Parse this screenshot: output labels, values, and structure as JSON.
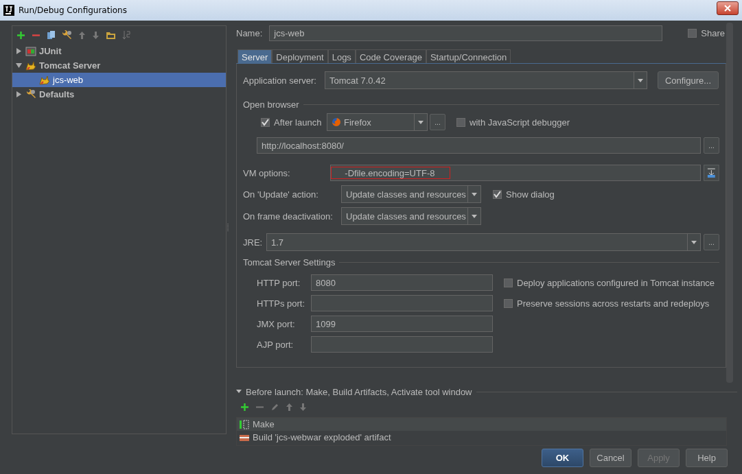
{
  "window": {
    "title": "Run/Debug Configurations"
  },
  "tree": [
    {
      "label": "JUnit",
      "kind": "junit",
      "expanded": false,
      "selected": false
    },
    {
      "label": "Tomcat Server",
      "kind": "tomcat",
      "expanded": true,
      "selected": false,
      "children": [
        {
          "label": "jcs-web",
          "kind": "tomcat-config",
          "selected": true
        }
      ]
    },
    {
      "label": "Defaults",
      "kind": "defaults",
      "expanded": false,
      "selected": false
    }
  ],
  "name": {
    "label": "Name:",
    "value": "jcs-web"
  },
  "share": {
    "label": "Share",
    "checked": false
  },
  "tabs": [
    {
      "label": "Server",
      "selected": true
    },
    {
      "label": "Deployment",
      "selected": false
    },
    {
      "label": "Logs",
      "selected": false
    },
    {
      "label": "Code Coverage",
      "selected": false
    },
    {
      "label": "Startup/Connection",
      "selected": false
    }
  ],
  "server": {
    "app_server": {
      "label": "Application server:",
      "value": "Tomcat 7.0.42",
      "button": "Configure..."
    },
    "open_browser": {
      "title": "Open browser",
      "after_launch": {
        "label": "After launch",
        "checked": true
      },
      "browser": "Firefox",
      "more": "...",
      "js_debugger": {
        "label": "with JavaScript debugger",
        "checked": false
      },
      "url": "http://localhost:8080/",
      "url_more": "..."
    },
    "vm_options": {
      "label": "VM options:",
      "value": "-Dfile.encoding=UTF-8"
    },
    "update_action": {
      "label": "On 'Update' action:",
      "value": "Update classes and resources",
      "show_dialog": {
        "label": "Show dialog",
        "checked": true
      }
    },
    "frame_deactivation": {
      "label": "On frame deactivation:",
      "value": "Update classes and resources"
    },
    "jre": {
      "label": "JRE:",
      "value": "1.7",
      "more": "..."
    },
    "tomcat_settings": {
      "title": "Tomcat Server Settings",
      "ports": [
        {
          "label": "HTTP port:",
          "value": "8080"
        },
        {
          "label": "HTTPs port:"
        },
        {
          "label": "JMX port:",
          "value": "1099"
        },
        {
          "label": "AJP port:"
        }
      ],
      "options": [
        {
          "label": "Deploy applications configured in Tomcat instance",
          "checked": false
        },
        {
          "label": "Preserve sessions across restarts and redeploys",
          "checked": false
        }
      ]
    }
  },
  "before_launch": {
    "title": "Before launch: Make, Build Artifacts, Activate tool window",
    "expanded": true,
    "tasks": [
      {
        "label": "Make",
        "kind": "make",
        "selected": true
      },
      {
        "label": "Build 'jcs-webwar exploded' artifact",
        "kind": "artifact",
        "selected": false
      }
    ]
  },
  "buttons": [
    {
      "label": "OK",
      "kind": "default",
      "disabled": false
    },
    {
      "label": "Cancel",
      "kind": "normal",
      "disabled": false
    },
    {
      "label": "Apply",
      "kind": "normal",
      "disabled": true
    },
    {
      "label": "Help",
      "kind": "normal",
      "disabled": false
    }
  ]
}
